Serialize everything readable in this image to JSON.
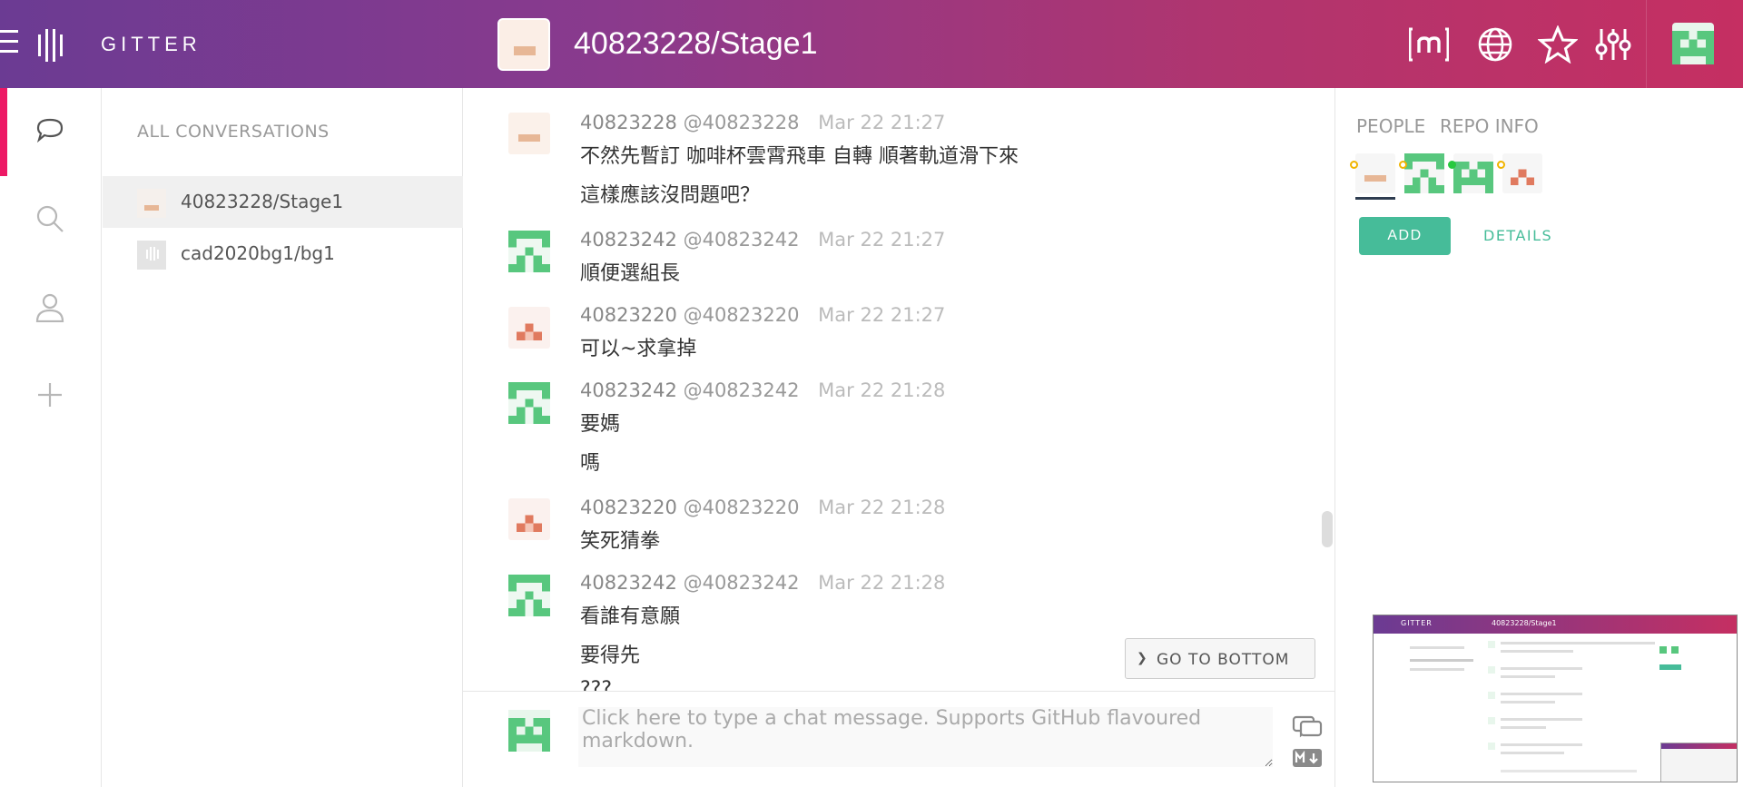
{
  "header": {
    "brand": "GITTER",
    "room_title": "40823228/Stage1",
    "icons": [
      "matrix-icon",
      "globe-icon",
      "star-icon",
      "settings-sliders-icon"
    ]
  },
  "rail": {
    "icons": [
      "chat-bubble-icon",
      "search-icon",
      "person-icon",
      "plus-icon"
    ]
  },
  "conversations": {
    "title": "ALL CONVERSATIONS",
    "items": [
      {
        "label": "40823228/Stage1",
        "active": true
      },
      {
        "label": "cad2020bg1/bg1",
        "active": false
      }
    ]
  },
  "messages": [
    {
      "display_name": "40823228",
      "username": "@40823228",
      "time": "Mar 22 21:27",
      "lines": [
        "不然先暫訂 咖啡杯雲霄飛車 自轉 順著軌道滑下來",
        "這樣應該沒問題吧？"
      ]
    },
    {
      "display_name": "40823242",
      "username": "@40823242",
      "time": "Mar 22 21:27",
      "lines": [
        "順便選組長"
      ]
    },
    {
      "display_name": "40823220",
      "username": "@40823220",
      "time": "Mar 22 21:27",
      "lines": [
        "可以~求拿掉"
      ]
    },
    {
      "display_name": "40823242",
      "username": "@40823242",
      "time": "Mar 22 21:28",
      "lines": [
        "要媽",
        "嗎"
      ]
    },
    {
      "display_name": "40823220",
      "username": "@40823220",
      "time": "Mar 22 21:28",
      "lines": [
        "笑死猜拳"
      ]
    },
    {
      "display_name": "40823242",
      "username": "@40823242",
      "time": "Mar 22 21:28",
      "lines": [
        "看誰有意願",
        "要得先",
        "???"
      ]
    }
  ],
  "go_to_bottom": "GO TO BOTTOM",
  "composer": {
    "placeholder": "Click here to type a chat message. Supports GitHub flavoured markdown."
  },
  "right_panel": {
    "tabs": [
      "PEOPLE",
      "REPO INFO"
    ],
    "add_label": "ADD",
    "details_label": "DETAILS"
  },
  "thumbnail": {
    "brand": "GITTER",
    "title": "40823228/Stage1"
  },
  "colors": {
    "accent_green": "#46bc99",
    "active_pink": "#ed1965",
    "header_start": "#6b3b93",
    "header_end": "#c52f62"
  }
}
